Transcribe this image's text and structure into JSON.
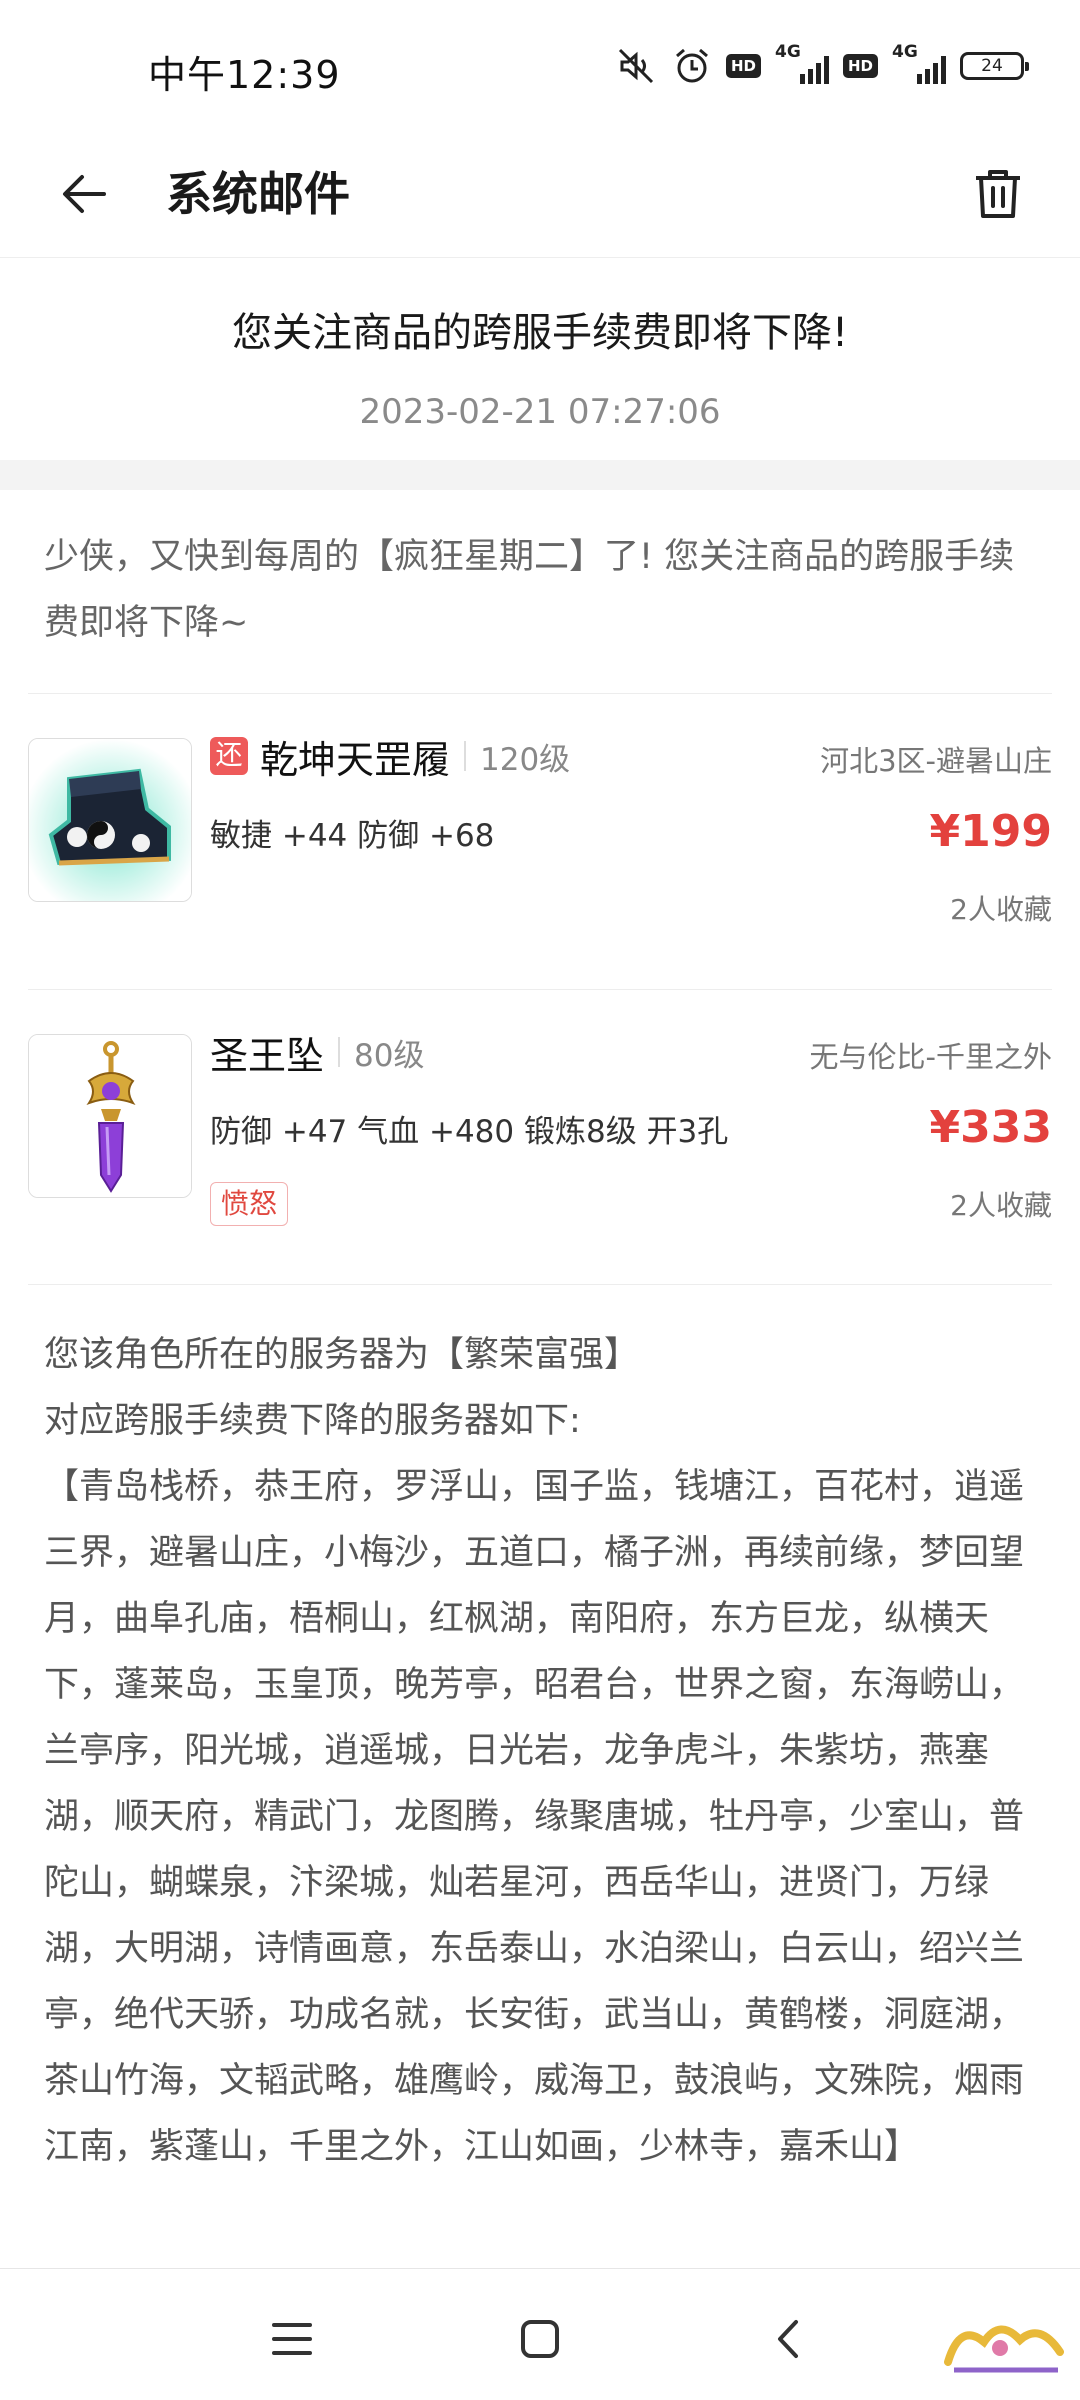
{
  "status_bar": {
    "time": "中午12:39",
    "battery": "24",
    "hd_badge": "HD",
    "network": "4G"
  },
  "header": {
    "title": "系统邮件",
    "back_icon": "arrow-left-icon",
    "trash_icon": "trash-icon"
  },
  "mail": {
    "subject": "您关注商品的跨服手续费即将下降!",
    "date": "2023-02-21 07:27:06",
    "intro": "少侠，又快到每周的【疯狂星期二】了! 您关注商品的跨服手续费即将下降~"
  },
  "items": [
    {
      "tag": "还",
      "name": "乾坤天罡履",
      "level": "120级",
      "server": "河北3区-避暑山庄",
      "stats": "敏捷 +44 防御 +68",
      "price": "¥199",
      "favorites": "2人收藏",
      "image_icon": "boots-icon"
    },
    {
      "name": "圣王坠",
      "level": "80级",
      "server": "无与伦比-千里之外",
      "stats": "防御 +47 气血 +480 锻炼8级 开3孔",
      "extra_tag": "愤怒",
      "price": "¥333",
      "favorites": "2人收藏",
      "image_icon": "pendant-icon"
    }
  ],
  "notice": {
    "line1": "您该角色所在的服务器为【繁荣富强】",
    "line2": "对应跨服手续费下降的服务器如下:",
    "servers": "【青岛栈桥，恭王府，罗浮山，国子监，钱塘江，百花村，逍遥三界，避暑山庄，小梅沙，五道口，橘子洲，再续前缘，梦回望月，曲阜孔庙，梧桐山，红枫湖，南阳府，东方巨龙，纵横天下，蓬莱岛，玉皇顶，晚芳亭，昭君台，世界之窗，东海崂山，兰亭序，阳光城，逍遥城，日光岩，龙争虎斗，朱紫坊，燕塞湖，顺天府，精武门，龙图腾，缘聚唐城，牡丹亭，少室山，普陀山，蝴蝶泉，汴梁城，灿若星河，西岳华山，进贤门，万绿湖，大明湖，诗情画意，东岳泰山，水泊梁山，白云山，绍兴兰亭，绝代天骄，功成名就，长安街，武当山，黄鹤楼，洞庭湖，茶山竹海，文韬武略，雄鹰岭，威海卫，鼓浪屿，文殊院，烟雨江南，紫蓬山，千里之外，江山如画，少林寺，嘉禾山】"
  },
  "nav": {
    "menu_icon": "menu-icon",
    "home_icon": "home-icon",
    "back_icon": "back-chevron-icon"
  },
  "colors": {
    "price": "#e3413d",
    "tag": "#ee5a5a",
    "muted_text": "#666666"
  }
}
